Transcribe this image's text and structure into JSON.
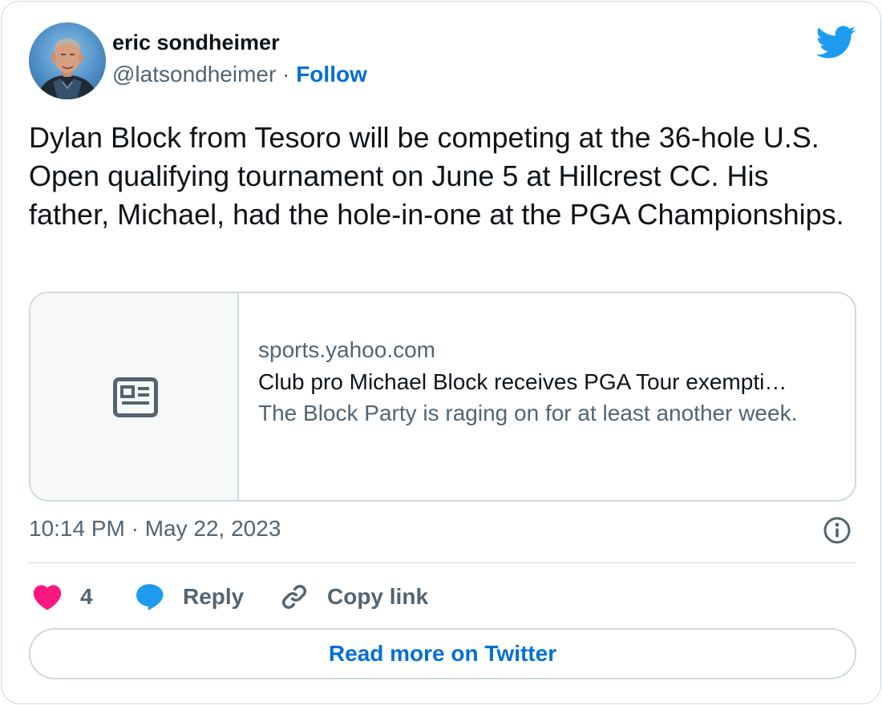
{
  "author": {
    "name": "eric sondheimer",
    "handle": "@latsondheimer",
    "separator": "·",
    "follow_label": "Follow"
  },
  "tweet": {
    "text": "Dylan Block from Tesoro will be competing at the 36-hole U.S. Open qualifying tournament on June 5 at Hillcrest CC. His father, Michael, had the hole-in-one at the PGA Championships."
  },
  "link_card": {
    "domain": "sports.yahoo.com",
    "title": "Club pro Michael Block receives PGA Tour exempti…",
    "description": "The Block Party is raging on for at least another week.",
    "thumbnail_icon": "news-article-icon"
  },
  "meta": {
    "timestamp": "10:14 PM · May 22, 2023"
  },
  "actions": {
    "like_count": "4",
    "reply_label": "Reply",
    "copy_link_label": "Copy link"
  },
  "footer": {
    "read_more_label": "Read more on Twitter"
  },
  "colors": {
    "accent": "#006fd6",
    "twitter_blue": "#1d9bf0",
    "like_pink": "#f91880",
    "muted_text": "#536471",
    "border": "#cfd9de"
  }
}
